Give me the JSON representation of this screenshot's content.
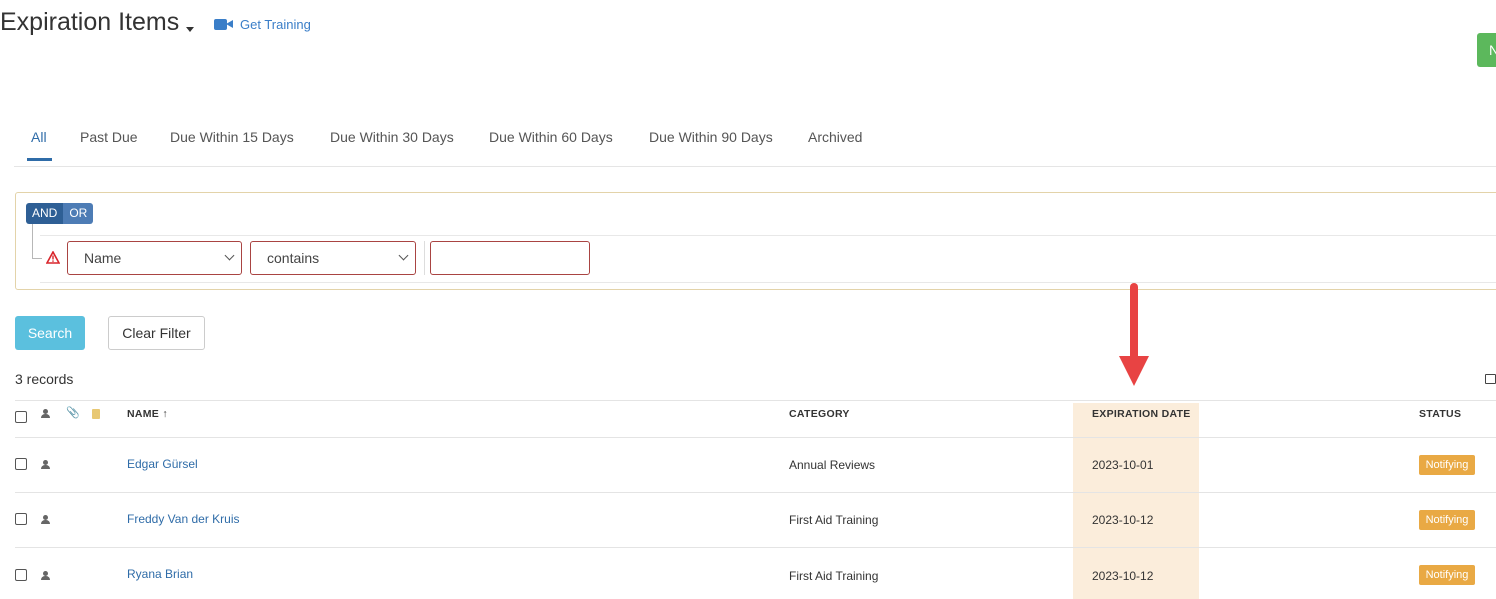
{
  "header": {
    "title": "Expiration Items",
    "training_link": "Get Training",
    "new_button": "N"
  },
  "tabs": [
    {
      "label": "All",
      "active": true
    },
    {
      "label": "Past Due"
    },
    {
      "label": "Due Within 15 Days"
    },
    {
      "label": "Due Within 30 Days"
    },
    {
      "label": "Due Within 60 Days"
    },
    {
      "label": "Due Within 90 Days"
    },
    {
      "label": "Archived"
    }
  ],
  "filter": {
    "and_label": "AND",
    "or_label": "OR",
    "field_select": "Name",
    "operator_select": "contains",
    "value": ""
  },
  "actions": {
    "search_label": "Search",
    "clear_label": "Clear Filter"
  },
  "records_count": "3 records",
  "table": {
    "headers": {
      "name": "NAME ↑",
      "category": "CATEGORY",
      "expiration_date": "EXPIRATION DATE",
      "status": "STATUS"
    },
    "rows": [
      {
        "name": "Edgar Gürsel",
        "category": "Annual Reviews",
        "expiration_date": "2023-10-01",
        "status": "Notifying"
      },
      {
        "name": "Freddy Van der Kruis",
        "category": "First Aid Training",
        "expiration_date": "2023-10-12",
        "status": "Notifying"
      },
      {
        "name": "Ryana Brian",
        "category": "First Aid Training",
        "expiration_date": "2023-10-12",
        "status": "Notifying"
      }
    ]
  },
  "colors": {
    "accent": "#2f6ca8",
    "search_button": "#5bc0de",
    "new_button": "#5cb85c",
    "status_badge": "#e9a944",
    "column_highlight": "#fbeddb",
    "annotation_arrow": "#e84343"
  }
}
